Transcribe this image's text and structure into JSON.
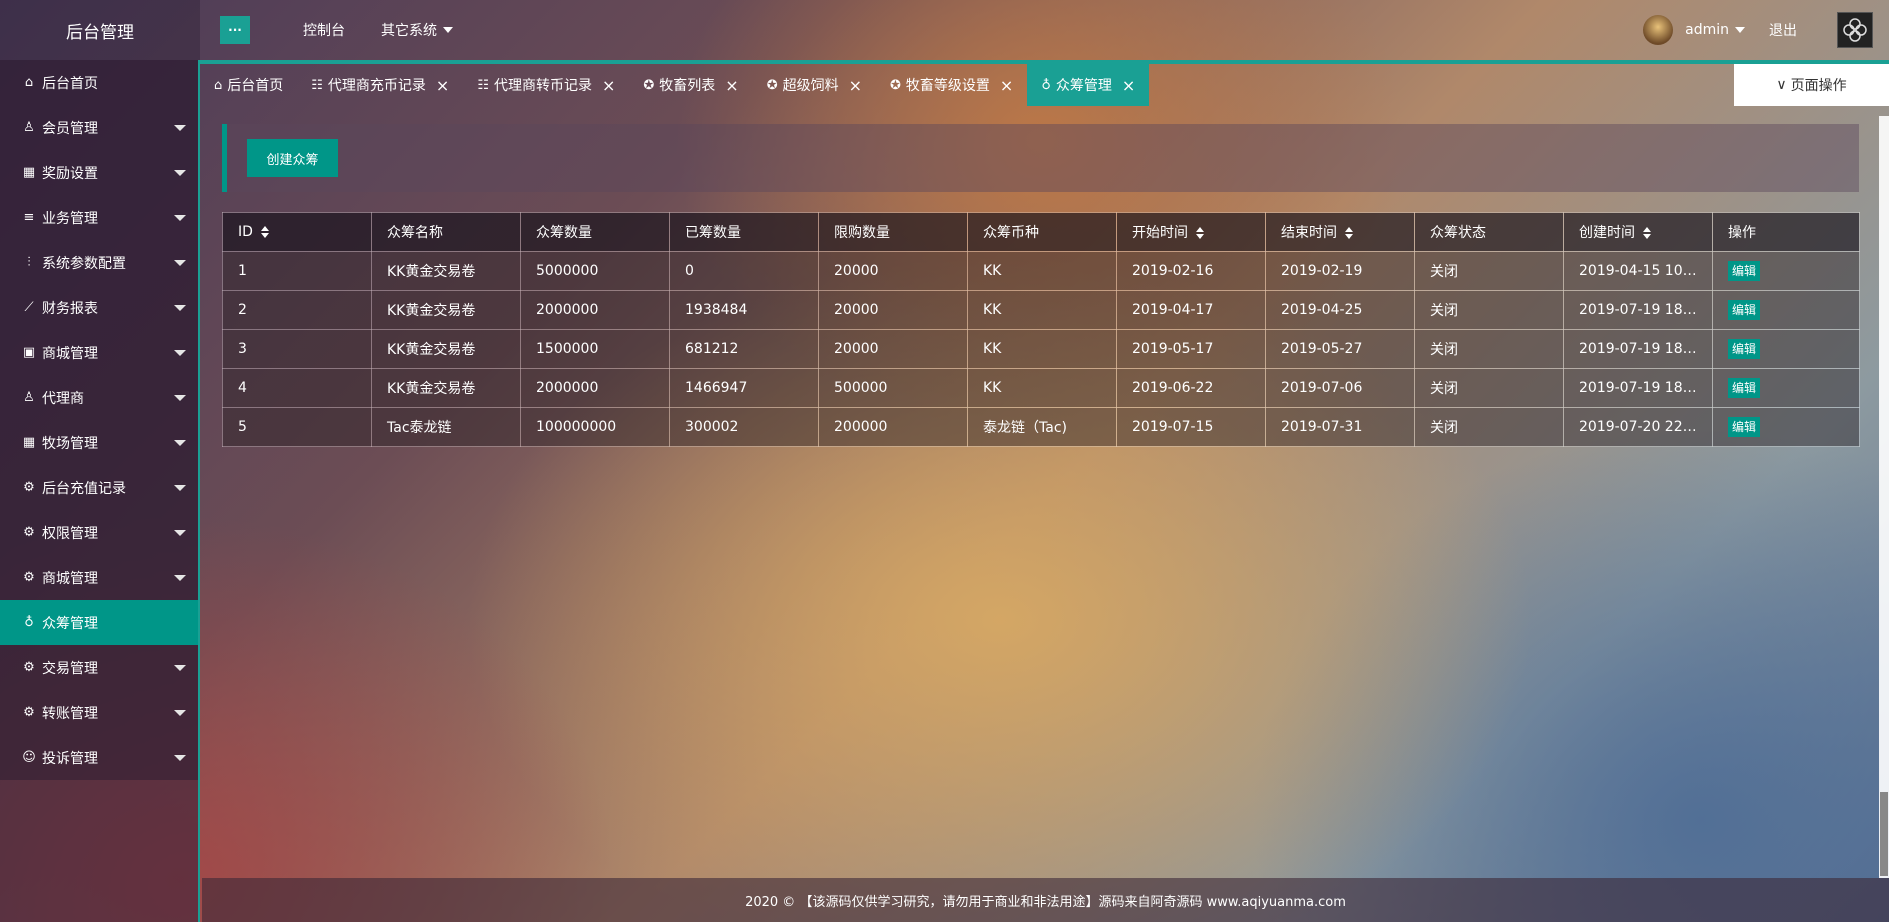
{
  "header": {
    "logo": "后台管理",
    "toggle_icon": "···",
    "nav": [
      {
        "label": "控制台"
      },
      {
        "label": "其它系统"
      }
    ],
    "user": "admin",
    "logout": "退出"
  },
  "sidebar": {
    "items": [
      {
        "icon": "⌂",
        "label": "后台首页",
        "has_children": false
      },
      {
        "icon": "♙",
        "label": "会员管理",
        "has_children": true
      },
      {
        "icon": "▦",
        "label": "奖励设置",
        "has_children": true
      },
      {
        "icon": "≡",
        "label": "业务管理",
        "has_children": true
      },
      {
        "icon": "⫶",
        "label": "系统参数配置",
        "has_children": true
      },
      {
        "icon": "⟋",
        "label": "财务报表",
        "has_children": true
      },
      {
        "icon": "▣",
        "label": "商城管理",
        "has_children": true
      },
      {
        "icon": "♙",
        "label": "代理商",
        "has_children": true
      },
      {
        "icon": "▦",
        "label": "牧场管理",
        "has_children": true
      },
      {
        "icon": "⚙",
        "label": "后台充值记录",
        "has_children": true
      },
      {
        "icon": "⚙",
        "label": "权限管理",
        "has_children": true
      },
      {
        "icon": "⚙",
        "label": "商城管理",
        "has_children": true
      },
      {
        "icon": "♁",
        "label": "众筹管理",
        "has_children": false
      },
      {
        "icon": "⚙",
        "label": "交易管理",
        "has_children": true
      },
      {
        "icon": "⚙",
        "label": "转账管理",
        "has_children": true
      },
      {
        "icon": "☺",
        "label": "投诉管理",
        "has_children": true
      }
    ],
    "active_index": 12
  },
  "tabs": [
    {
      "icon": "⌂",
      "label": "后台首页",
      "closable": false
    },
    {
      "icon": "☷",
      "label": "代理商充币记录",
      "closable": true
    },
    {
      "icon": "☷",
      "label": "代理商转币记录",
      "closable": true
    },
    {
      "icon": "✪",
      "label": "牧畜列表",
      "closable": true
    },
    {
      "icon": "✪",
      "label": "超级饲料",
      "closable": true
    },
    {
      "icon": "✪",
      "label": "牧畜等级设置",
      "closable": true
    },
    {
      "icon": "♁",
      "label": "众筹管理",
      "closable": true
    }
  ],
  "active_tab": 6,
  "page_ops": "页面操作",
  "toolbar": {
    "create_label": "创建众筹"
  },
  "table": {
    "columns": [
      {
        "label": "ID",
        "sortable": true
      },
      {
        "label": "众筹名称",
        "sortable": false
      },
      {
        "label": "众筹数量",
        "sortable": false
      },
      {
        "label": "已筹数量",
        "sortable": false
      },
      {
        "label": "限购数量",
        "sortable": false
      },
      {
        "label": "众筹币种",
        "sortable": false
      },
      {
        "label": "开始时间",
        "sortable": true
      },
      {
        "label": "结束时间",
        "sortable": true
      },
      {
        "label": "众筹状态",
        "sortable": false
      },
      {
        "label": "创建时间",
        "sortable": true
      },
      {
        "label": "操作",
        "sortable": false
      }
    ],
    "rows": [
      [
        "1",
        "KK黄金交易卷",
        "5000000",
        "0",
        "20000",
        "KK",
        "2019-02-16",
        "2019-02-19",
        "关闭",
        "2019-04-15 10:5..."
      ],
      [
        "2",
        "KK黄金交易卷",
        "2000000",
        "1938484",
        "20000",
        "KK",
        "2019-04-17",
        "2019-04-25",
        "关闭",
        "2019-07-19 18:0..."
      ],
      [
        "3",
        "KK黄金交易卷",
        "1500000",
        "681212",
        "20000",
        "KK",
        "2019-05-17",
        "2019-05-27",
        "关闭",
        "2019-07-19 18:0..."
      ],
      [
        "4",
        "KK黄金交易卷",
        "2000000",
        "1466947",
        "500000",
        "KK",
        "2019-06-22",
        "2019-07-06",
        "关闭",
        "2019-07-19 18:0..."
      ],
      [
        "5",
        "Tac泰龙链",
        "100000000",
        "300002",
        "200000",
        "泰龙链（Tac)",
        "2019-07-15",
        "2019-07-31",
        "关闭",
        "2019-07-20 22:1..."
      ]
    ],
    "edit_label": "编辑"
  },
  "footer": "2020 © 【该源码仅供学习研究，请勿用于商业和非法用途】源码来自阿奇源码 www.aqiyuanma.com"
}
